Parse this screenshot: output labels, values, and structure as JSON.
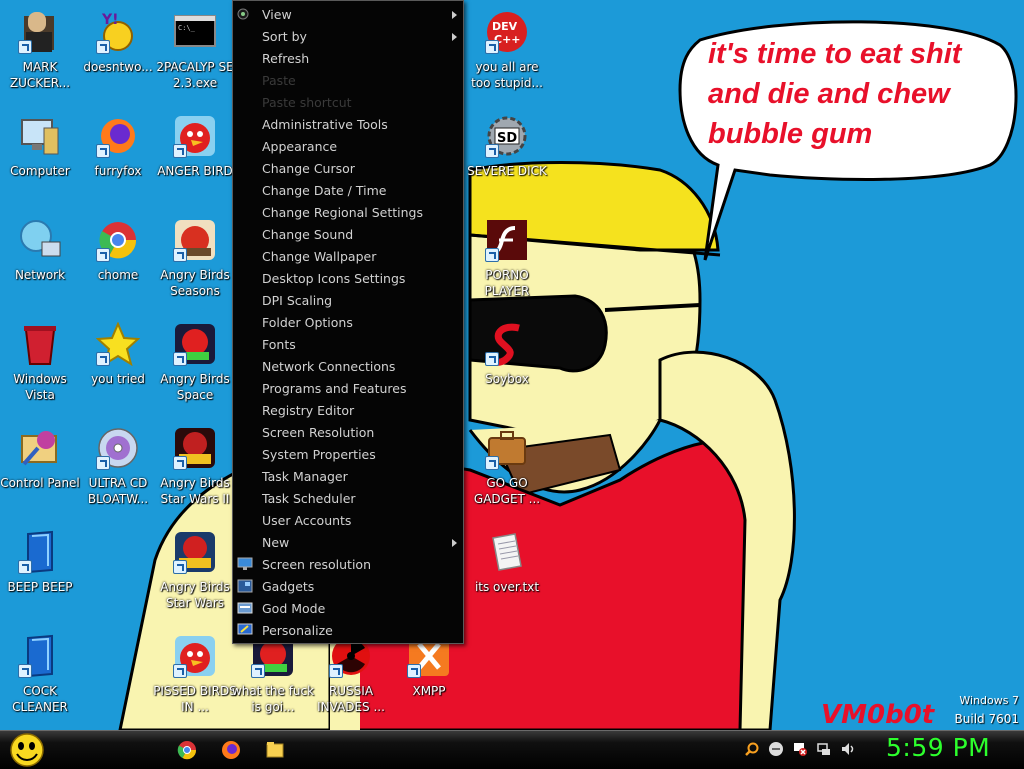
{
  "desktop_icons": [
    {
      "label": "MARK ZUCKER...",
      "icon": "zuckerberg-icon"
    },
    {
      "label": "Computer",
      "icon": "computer-icon"
    },
    {
      "label": "Network",
      "icon": "network-icon"
    },
    {
      "label": "Windows Vista",
      "icon": "recycle-bin-icon"
    },
    {
      "label": "Control Panel",
      "icon": "control-panel-icon"
    },
    {
      "label": "BEEP BEEP",
      "icon": "blue-book-icon"
    },
    {
      "label": "COCK CLEANER",
      "icon": "blue-book-icon"
    },
    {
      "label": "doesntwo...",
      "icon": "yahoo-messenger-icon"
    },
    {
      "label": "furryfox",
      "icon": "firefox-icon"
    },
    {
      "label": "chome",
      "icon": "chrome-icon"
    },
    {
      "label": "you tried",
      "icon": "star-icon"
    },
    {
      "label": "ULTRA CD BLOATW...",
      "icon": "cd-icon"
    },
    {
      "label": "2PACALYP SE 2.3.exe",
      "icon": "console-icon"
    },
    {
      "label": "ANGER BIRD",
      "icon": "angry-bird-icon"
    },
    {
      "label": "Angry Birds Seasons",
      "icon": "angry-birds-seasons-icon"
    },
    {
      "label": "Angry Birds Space",
      "icon": "angry-birds-space-icon"
    },
    {
      "label": "Angry Birds Star Wars II",
      "icon": "angry-birds-starwars2-icon"
    },
    {
      "label": "Angry Birds Star Wars",
      "icon": "angry-birds-starwars-icon"
    },
    {
      "label": "PISSED BIRDS IN ...",
      "icon": "angry-bird-icon"
    },
    {
      "label": "what the fuck is goi...",
      "icon": "angry-birds-space-icon"
    },
    {
      "label": "RUSSIA INVADES ...",
      "icon": "radiation-icon"
    },
    {
      "label": "XMPP",
      "icon": "xampp-icon"
    },
    {
      "label": "you all are too stupid...",
      "icon": "devcpp-icon"
    },
    {
      "label": "SEVERE DICK",
      "icon": "sd-gear-icon"
    },
    {
      "label": "PORNO PLAYER",
      "icon": "flash-icon"
    },
    {
      "label": "Soybox",
      "icon": "soybox-icon"
    },
    {
      "label": "GO GO GADGET ...",
      "icon": "briefcase-icon"
    },
    {
      "label": "its over.txt",
      "icon": "text-file-icon"
    }
  ],
  "context_menu": {
    "items": [
      {
        "label": "View",
        "submenu": true
      },
      {
        "label": "Sort by",
        "submenu": true
      },
      {
        "label": "Refresh"
      },
      {
        "label": "Paste",
        "disabled": true
      },
      {
        "label": "Paste shortcut",
        "disabled": true
      },
      {
        "label": "Administrative Tools"
      },
      {
        "label": "Appearance"
      },
      {
        "label": "Change Cursor"
      },
      {
        "label": "Change Date / Time"
      },
      {
        "label": "Change Regional Settings"
      },
      {
        "label": "Change Sound"
      },
      {
        "label": "Change Wallpaper"
      },
      {
        "label": "Desktop Icons Settings"
      },
      {
        "label": "DPI Scaling"
      },
      {
        "label": "Folder Options"
      },
      {
        "label": "Fonts"
      },
      {
        "label": "Network Connections"
      },
      {
        "label": "Programs and Features"
      },
      {
        "label": "Registry Editor"
      },
      {
        "label": "Screen Resolution"
      },
      {
        "label": "System Properties"
      },
      {
        "label": "Task Manager"
      },
      {
        "label": "Task Scheduler"
      },
      {
        "label": "User Accounts"
      },
      {
        "label": "New",
        "submenu": true
      },
      {
        "label": "Screen resolution",
        "icon": "monitor-icon"
      },
      {
        "label": "Gadgets",
        "icon": "gadgets-icon"
      },
      {
        "label": "God Mode",
        "icon": "control-panel-small-icon"
      },
      {
        "label": "Personalize",
        "icon": "personalize-icon"
      }
    ]
  },
  "wallpaper": {
    "speech_bubble": "it's time to eat shit and die and chew bubble gum",
    "signature": "VM0b0t",
    "colors": {
      "sky": "#1c9ad8",
      "skin": "#f9f4b0",
      "hat": "#f5e21e",
      "shirt": "#e8102a",
      "text": "#e8102a"
    }
  },
  "windows_version": {
    "line1": "Windows 7",
    "line2": "Build 7601"
  },
  "taskbar": {
    "pinned": [
      "chrome-icon",
      "firefox-icon",
      "folder-icon"
    ],
    "tray": [
      "search-icon",
      "messenger-icon",
      "flag-icon",
      "network-icon",
      "volume-icon"
    ],
    "clock": "5:59 PM",
    "clock_color": "#2dff2d"
  }
}
